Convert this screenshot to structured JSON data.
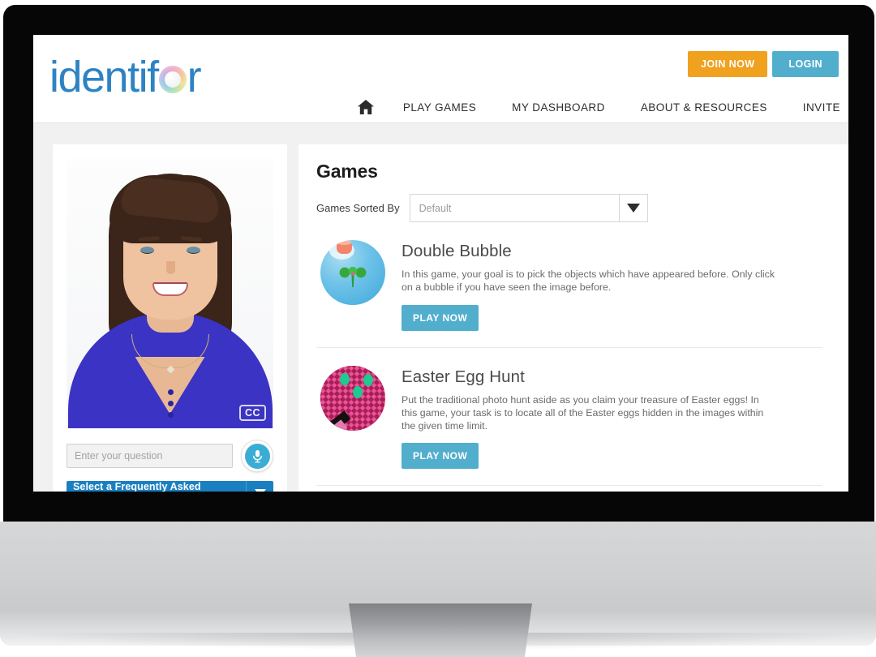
{
  "site": {
    "logo_text_before": "identif",
    "logo_icon": "rainbow-circle-o",
    "logo_text_after": "r"
  },
  "header": {
    "join_now_label": "JOIN NOW",
    "login_label": "LOGIN",
    "join_now_color": "#f0a11e",
    "login_color": "#52aecd"
  },
  "nav": {
    "home_icon": "home-icon",
    "items": [
      {
        "label": "PLAY GAMES"
      },
      {
        "label": "MY DASHBOARD"
      },
      {
        "label": "ABOUT & RESOURCES"
      },
      {
        "label": "INVITE"
      }
    ]
  },
  "avatar_panel": {
    "cc_badge": "CC",
    "question_placeholder": "Enter your question",
    "question_value": "",
    "mic_icon": "microphone-icon",
    "faq_dropdown_label": "Select a Frequently Asked Question",
    "faq_dropdown_color": "#1a7fc1"
  },
  "games": {
    "title": "Games",
    "sort_label": "Games Sorted By",
    "sort_value": "Default",
    "sort_options": [
      "Default"
    ],
    "play_label": "PLAY NOW",
    "items": [
      {
        "name": "Double Bubble",
        "description": "In this game, your goal is to pick the objects which have appeared before. Only click on a bubble if you have seen the image before.",
        "icon": "blue-bubble-icon",
        "play_label": "PLAY NOW"
      },
      {
        "name": "Easter Egg Hunt",
        "description": "Put the traditional photo hunt aside as you claim your treasure of Easter eggs! In this game, your task is to locate all of the Easter eggs hidden in the images within the given time limit.",
        "icon": "pink-beads-eggs-icon",
        "play_label": "PLAY NOW"
      }
    ]
  }
}
